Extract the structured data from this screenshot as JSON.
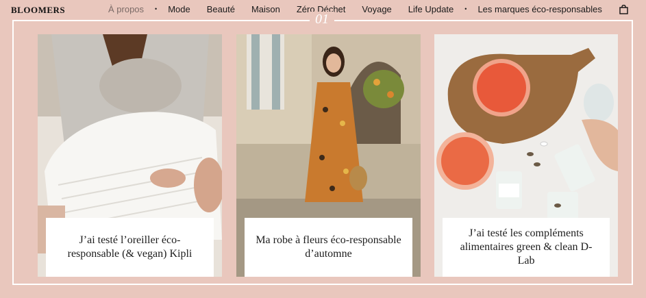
{
  "site": {
    "logo": "BLOOMERS"
  },
  "nav": {
    "items": [
      {
        "label": "À propos",
        "active": true
      },
      {
        "label": "Mode"
      },
      {
        "label": "Beauté"
      },
      {
        "label": "Maison"
      },
      {
        "label": "Zéro Déchet"
      },
      {
        "label": "Voyage"
      },
      {
        "label": "Life Update"
      },
      {
        "label": "Les marques éco-responsables"
      }
    ],
    "separator": "•",
    "cart_icon": "shopping-bag-icon"
  },
  "frame": {
    "mark": "01"
  },
  "articles": [
    {
      "title": "J’ai testé l’oreiller éco-responsable (& vegan) Kipli",
      "image": "woman-holding-white-pillow"
    },
    {
      "title": "Ma robe à fleurs éco-responsable d’automne",
      "image": "woman-in-floral-dress"
    },
    {
      "title": "J’ai testé les compléments alimentaires green & clean D-Lab",
      "image": "grapefruit-and-supplement-jars"
    }
  ],
  "colors": {
    "background": "#e9c7bd",
    "frame": "#ffffff",
    "text": "#1a1a1a",
    "active_nav": "#7a6a66"
  }
}
